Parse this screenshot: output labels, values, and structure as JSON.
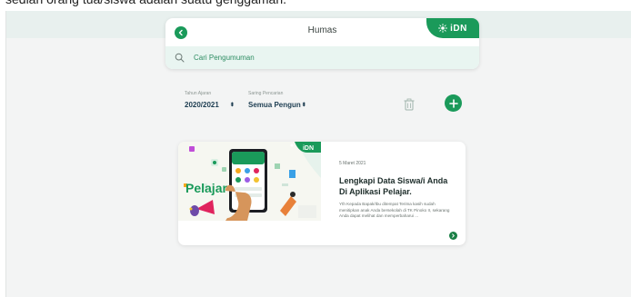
{
  "top_caption": "sedlah orang tua/siswa adalah suatu genggaman.",
  "header": {
    "title": "Humas",
    "logo_text": "iDN"
  },
  "search": {
    "placeholder": "Cari Pengumuman"
  },
  "filters": {
    "year": {
      "label": "Tahun Ajaran",
      "value": "2020/2021",
      "caret": "⬍"
    },
    "filter": {
      "label": "Saring Pencarian",
      "value": "Semua Pengun",
      "caret": "⬍"
    }
  },
  "post": {
    "image_word": "Pelajar",
    "image_logo": "iDN",
    "date": "5 Maret 2021",
    "title": "Lengkapi Data Siswa/i Anda Di Aplikasi Pelajar.",
    "excerpt": "Yth Kepada Bapak/Ibu ditempat Terima kasih sudah menitipkan anak Anda bersekolah di TK Pinoko II, sekarang Anda dapat melihat dan memperbaharui ..."
  },
  "colors": {
    "brand_green": "#1a9a5a",
    "search_bg": "#e9f5f1",
    "page_bg": "#f3f4f4"
  }
}
